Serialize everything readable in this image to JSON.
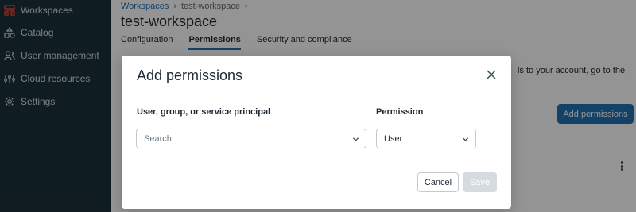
{
  "sidebar": {
    "items": [
      {
        "label": "Workspaces",
        "icon": "workspaces-icon"
      },
      {
        "label": "Catalog",
        "icon": "catalog-icon"
      },
      {
        "label": "User management",
        "icon": "user-management-icon"
      },
      {
        "label": "Cloud resources",
        "icon": "cloud-resources-icon"
      },
      {
        "label": "Settings",
        "icon": "gear-icon"
      }
    ]
  },
  "breadcrumb": {
    "root": "Workspaces",
    "separator": "›",
    "current": "test-workspace",
    "trailing_separator": "›"
  },
  "page": {
    "title": "test-workspace",
    "tabs": [
      {
        "label": "Configuration",
        "active": false
      },
      {
        "label": "Permissions",
        "active": true
      },
      {
        "label": "Security and compliance",
        "active": false
      }
    ],
    "partial_text_line1": "ls to your account, go to the",
    "add_permissions_button": "Add permissions"
  },
  "modal": {
    "title": "Add permissions",
    "principal_label": "User, group, or service principal",
    "principal_placeholder": "Search",
    "permission_label": "Permission",
    "permission_value": "User",
    "cancel_label": "Cancel",
    "save_label": "Save"
  },
  "colors": {
    "sidebar_bg": "#1b3139",
    "accent": "#2272b4",
    "logo_red": "#e8483b"
  }
}
